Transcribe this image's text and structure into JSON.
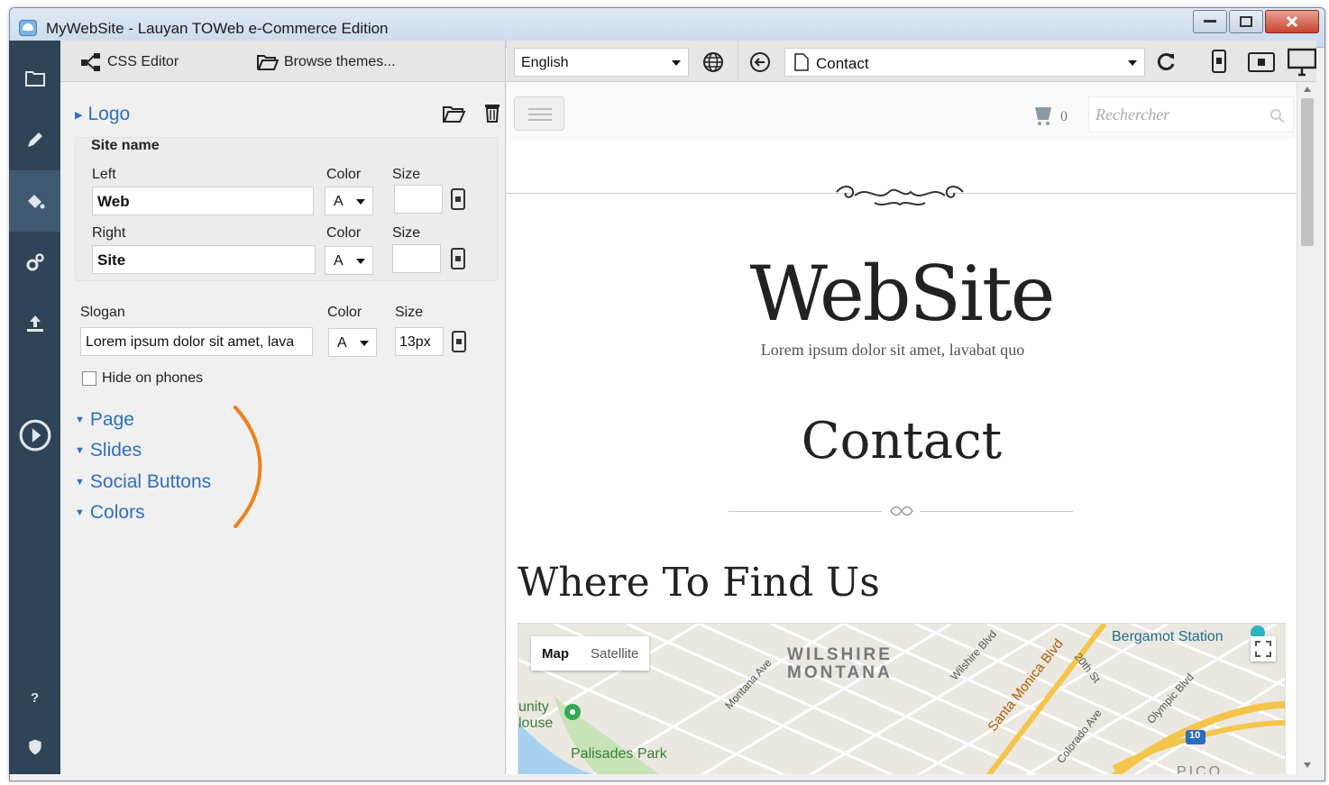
{
  "window": {
    "title": "MyWebSite - Lauyan TOWeb e-Commerce Edition"
  },
  "rail": {
    "items": [
      "folder-icon",
      "pencil-icon",
      "paint-bucket-icon",
      "gears-icon",
      "upload-icon",
      "play-icon",
      "help-icon",
      "shield-icon"
    ],
    "active": "paint-bucket-icon"
  },
  "toolbar": {
    "css_editor": "CSS Editor",
    "browse_themes": "Browse themes..."
  },
  "logo_section": {
    "title": "Logo",
    "site_name": {
      "heading": "Site name",
      "left_label": "Left",
      "left_value": "Web",
      "right_label": "Right",
      "right_value": "Site",
      "color_label": "Color",
      "size_label": "Size",
      "color_value": "A"
    },
    "slogan_label": "Slogan",
    "slogan_value": "Lorem ipsum dolor sit amet, lava",
    "slogan_color_label": "Color",
    "slogan_color_value": "A",
    "slogan_size_label": "Size",
    "slogan_size_value": "13px",
    "hide_on_phones": "Hide on phones",
    "hide_on_phones_checked": false
  },
  "sections": [
    "Page",
    "Slides",
    "Social Buttons",
    "Colors"
  ],
  "preview_toolbar": {
    "language": "English",
    "page": "Contact"
  },
  "site": {
    "cart_count": "0",
    "search_placeholder": "Rechercher",
    "title": "WebSite",
    "slogan": "Lorem ipsum dolor sit amet, lavabat quo",
    "page_heading": "Contact",
    "section_heading": "Where To Find Us"
  },
  "map": {
    "tabs": [
      "Map",
      "Satellite"
    ],
    "active_tab": "Map",
    "labels": [
      "WILSHIRE",
      "MONTANA",
      "Montana Ave",
      "Wilshire Blvd",
      "Santa Monica Blvd",
      "20th St",
      "Olympic Blvd",
      "Colorado Ave",
      "Bergamot Station",
      "Palisades Park",
      "unity",
      "louse",
      "10",
      "PICO"
    ]
  },
  "colors": {
    "link": "#2e6fc1",
    "rail": "#2f4456",
    "annotation": "#f07f1a"
  }
}
